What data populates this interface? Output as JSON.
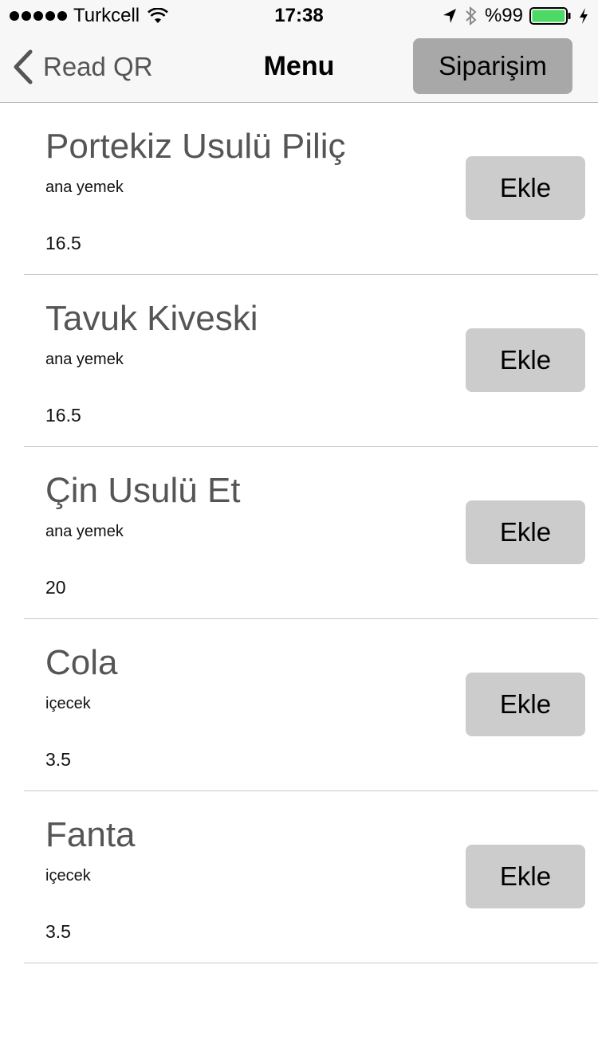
{
  "status_bar": {
    "carrier": "Turkcell",
    "time": "17:38",
    "battery_percent": "%99",
    "battery_level": 0.99,
    "battery_color": "#4cd964"
  },
  "nav": {
    "back_label": "Read QR",
    "title": "Menu",
    "order_button_label": "Siparişim"
  },
  "menu": {
    "items": [
      {
        "name": "Portekiz Usulü Piliç",
        "category": "ana yemek",
        "price": "16.5",
        "add_label": "Ekle"
      },
      {
        "name": "Tavuk Kiveski",
        "category": "ana yemek",
        "price": "16.5",
        "add_label": "Ekle"
      },
      {
        "name": "Çin Usulü Et",
        "category": "ana yemek",
        "price": "20",
        "add_label": "Ekle"
      },
      {
        "name": "Cola",
        "category": "içecek",
        "price": "3.5",
        "add_label": "Ekle"
      },
      {
        "name": "Fanta",
        "category": "içecek",
        "price": "3.5",
        "add_label": "Ekle"
      }
    ]
  },
  "icons": [
    "signal-icon",
    "wifi-icon",
    "location-arrow-icon",
    "bluetooth-icon",
    "battery-icon",
    "charging-bolt-icon",
    "back-chevron-icon"
  ]
}
